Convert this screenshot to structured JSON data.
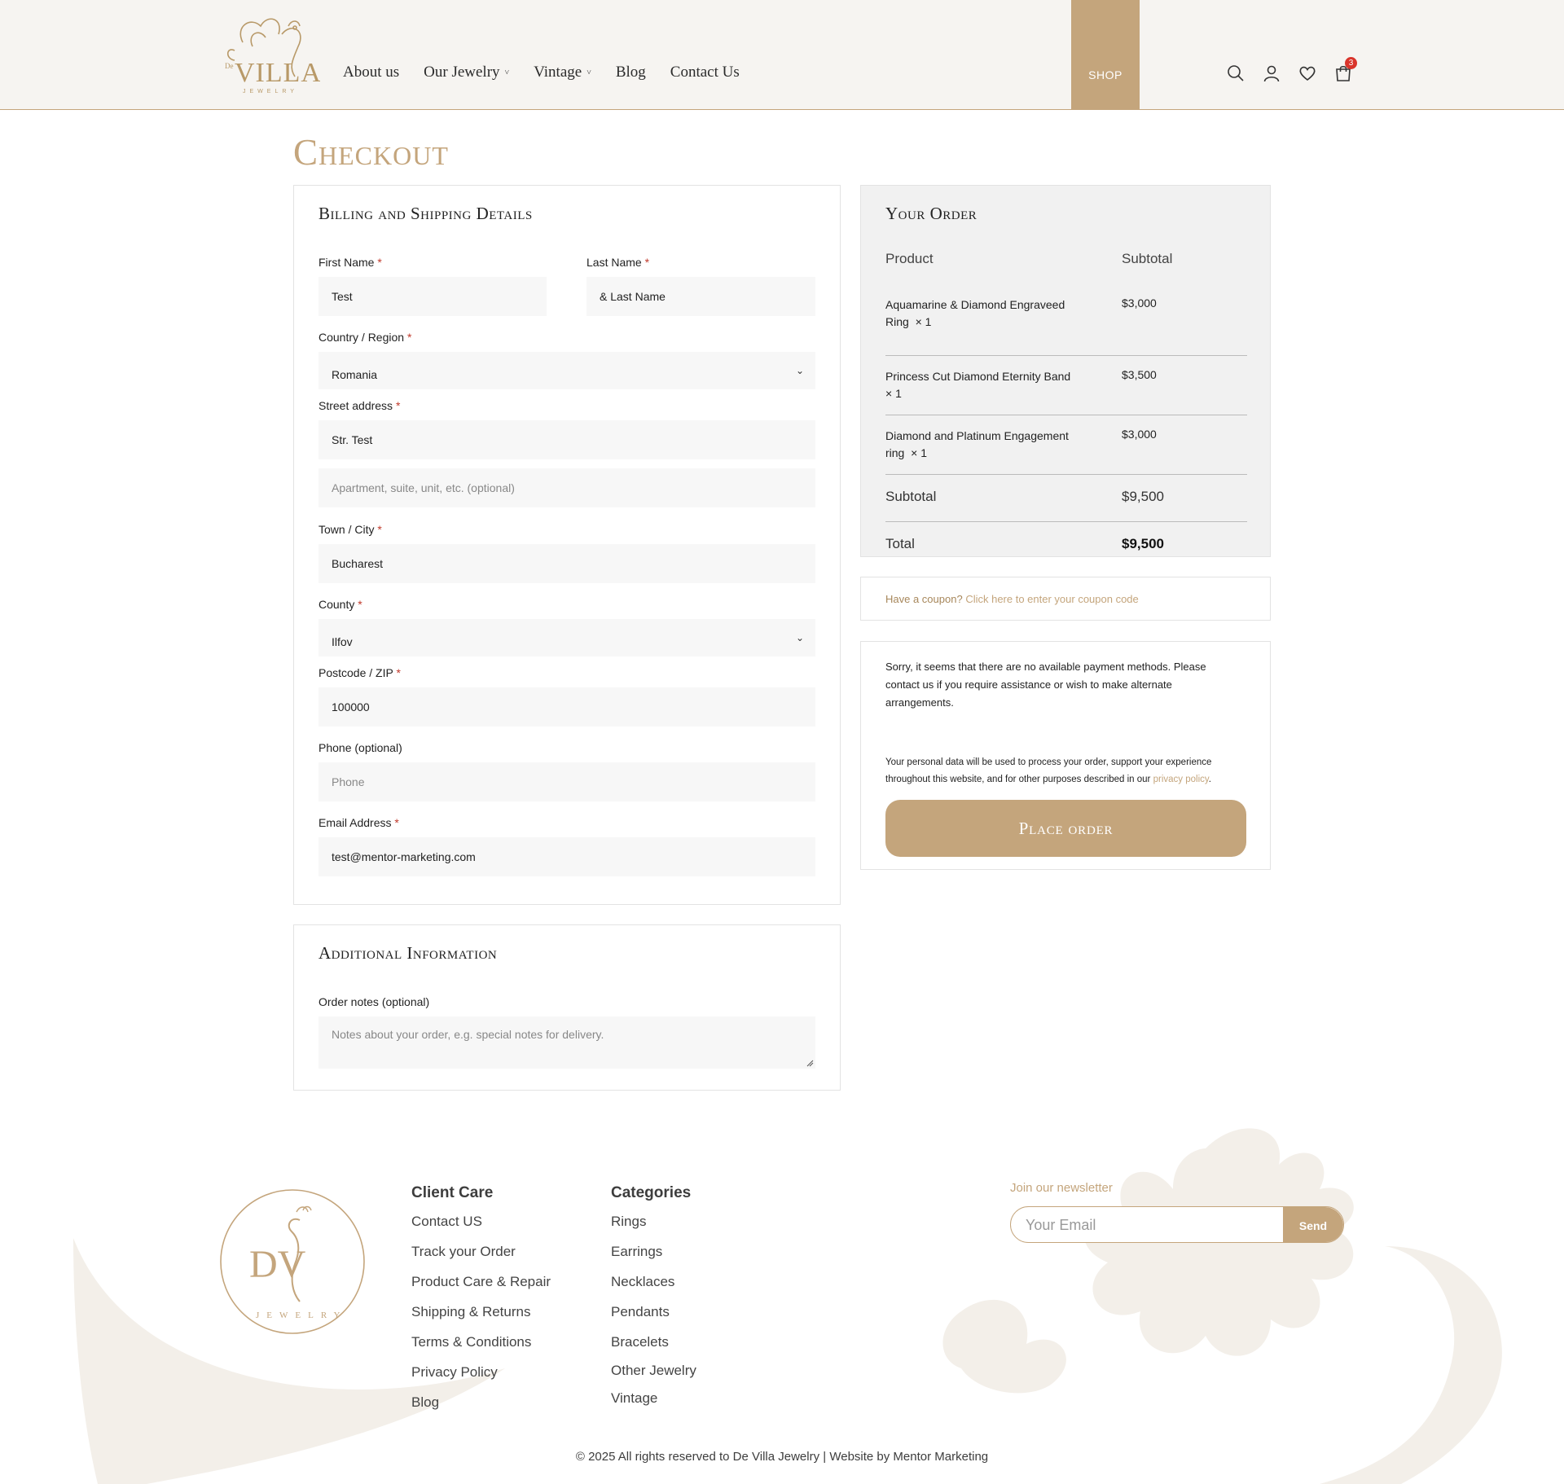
{
  "header": {
    "nav": [
      {
        "label": "About us",
        "dropdown": false
      },
      {
        "label": "Our Jewelry",
        "dropdown": true
      },
      {
        "label": "Vintage",
        "dropdown": true
      },
      {
        "label": "Blog",
        "dropdown": false
      },
      {
        "label": "Contact Us",
        "dropdown": false
      }
    ],
    "shop_label": "SHOP",
    "cart_count": "3",
    "logo_text": "VILLA",
    "logo_sub": "JEWELRY",
    "logo_prefix": "De"
  },
  "checkout": {
    "title": "Checkout",
    "billing": {
      "title": "Billing and Shipping Details",
      "first_name_label": "First Name",
      "first_name_value": "Test",
      "last_name_label": "Last Name",
      "last_name_value": "& Last Name",
      "country_label": "Country / Region",
      "country_value": "Romania",
      "street_label": "Street address",
      "street_value": "Str. Test",
      "street2_placeholder": "Apartment, suite, unit, etc. (optional)",
      "city_label": "Town / City",
      "city_value": "Bucharest",
      "county_label": "County",
      "county_value": "Ilfov",
      "postcode_label": "Postcode / ZIP",
      "postcode_value": "100000",
      "phone_label": "Phone (optional)",
      "phone_placeholder": "Phone",
      "email_label": "Email Address",
      "email_value": "test@mentor-marketing.com",
      "required_mark": "*"
    },
    "additional": {
      "title": "Additional Information",
      "notes_label": "Order notes (optional)",
      "notes_placeholder": "Notes about your order, e.g. special notes for delivery."
    },
    "order": {
      "title": "Your Order",
      "col_product": "Product",
      "col_subtotal": "Subtotal",
      "items": [
        {
          "name": "Aquamarine & Diamond Engraveed Ring",
          "qty": "× 1",
          "price": "$3,000"
        },
        {
          "name": "Princess Cut Diamond Eternity Band",
          "qty": "× 1",
          "price": "$3,500"
        },
        {
          "name": "Diamond and Platinum Engagement ring",
          "qty": "× 1",
          "price": "$3,000"
        }
      ],
      "subtotal_label": "Subtotal",
      "subtotal_value": "$9,500",
      "total_label": "Total",
      "total_value": "$9,500"
    },
    "coupon": {
      "prompt": "Have a coupon?",
      "link": "Click here to enter your coupon code"
    },
    "payment": {
      "message": "Sorry, it seems that there are no available payment methods. Please contact us if you require assistance or wish to make alternate arrangements.",
      "privacy_text": "Your personal data will be used to process your order, support your experience throughout this website, and for other purposes described in our",
      "privacy_link": "privacy policy",
      "privacy_end": ".",
      "place_order": "Place order"
    }
  },
  "footer": {
    "logo_letters": "DV",
    "logo_sub": "JEWELRY",
    "client_care": {
      "title": "Client Care",
      "links": [
        "Contact US",
        "Track your Order",
        "Product Care & Repair",
        "Shipping & Returns",
        "Terms & Conditions",
        "Privacy Policy",
        "Blog"
      ]
    },
    "categories": {
      "title": "Categories",
      "links": [
        "Rings",
        "Earrings",
        "Necklaces",
        "Pendants",
        "Bracelets",
        "Other Jewelry",
        "Vintage"
      ]
    },
    "newsletter": {
      "label": "Join our newsletter",
      "placeholder": "Your Email",
      "button": "Send"
    },
    "copyright": "© 2025 All rights reserved to De Villa Jewelry | Website by Mentor Marketing"
  },
  "colors": {
    "accent": "#c4a57c",
    "header_bg": "#f6f4f1",
    "order_bg": "#f1f1f1",
    "required": "#c0392b",
    "badge": "#d9342b"
  }
}
